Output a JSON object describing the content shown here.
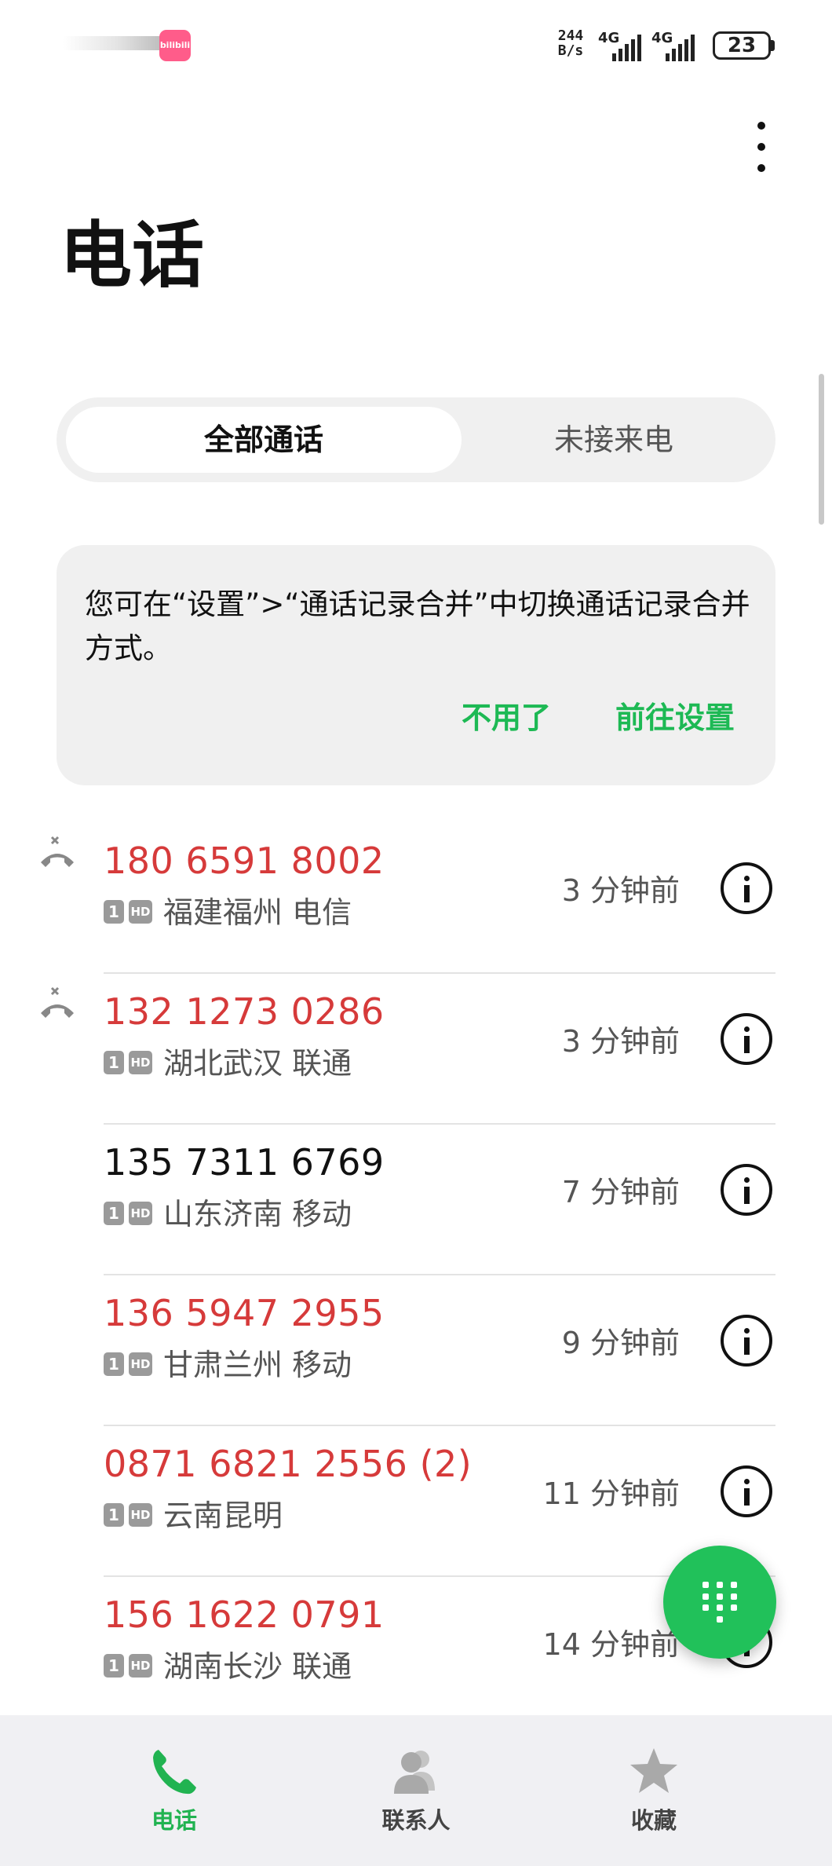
{
  "status_bar": {
    "app_badge": "bilibili",
    "net_speed_value": "244",
    "net_speed_unit": "B/s",
    "signal1_label": "4G",
    "signal2_label": "4G",
    "battery": "23"
  },
  "header": {
    "title": "电话"
  },
  "tabs": {
    "all": "全部通话",
    "missed": "未接来电"
  },
  "tip": {
    "text": "您可在“设置”>“通话记录合并”中切换通话记录合并方式。",
    "dismiss": "不用了",
    "goto_settings": "前往设置"
  },
  "calls": [
    {
      "number": "180 6591 8002",
      "location": "福建福州 电信",
      "time": "3 分钟前",
      "missed": true
    },
    {
      "number": "132 1273 0286",
      "location": "湖北武汉 联通",
      "time": "3 分钟前",
      "missed": true
    },
    {
      "number": "135 7311 6769",
      "location": "山东济南 移动",
      "time": "7 分钟前",
      "missed": false
    },
    {
      "number": "136 5947 2955",
      "location": "甘肃兰州 移动",
      "time": "9 分钟前",
      "missed": false
    },
    {
      "number": "0871 6821 2556 (2)",
      "location": "云南昆明",
      "time": "11 分钟前",
      "missed": false
    },
    {
      "number": "156 1622 0791",
      "location": "湖南长沙 联通",
      "time": "14 分钟前",
      "missed": false
    }
  ],
  "sim_tag": "1",
  "hd_tag": "HD",
  "nav": {
    "phone": "电话",
    "contacts": "联系人",
    "favorites": "收藏"
  },
  "colors": {
    "accent": "#21c15a",
    "missed": "#d63a3a"
  }
}
